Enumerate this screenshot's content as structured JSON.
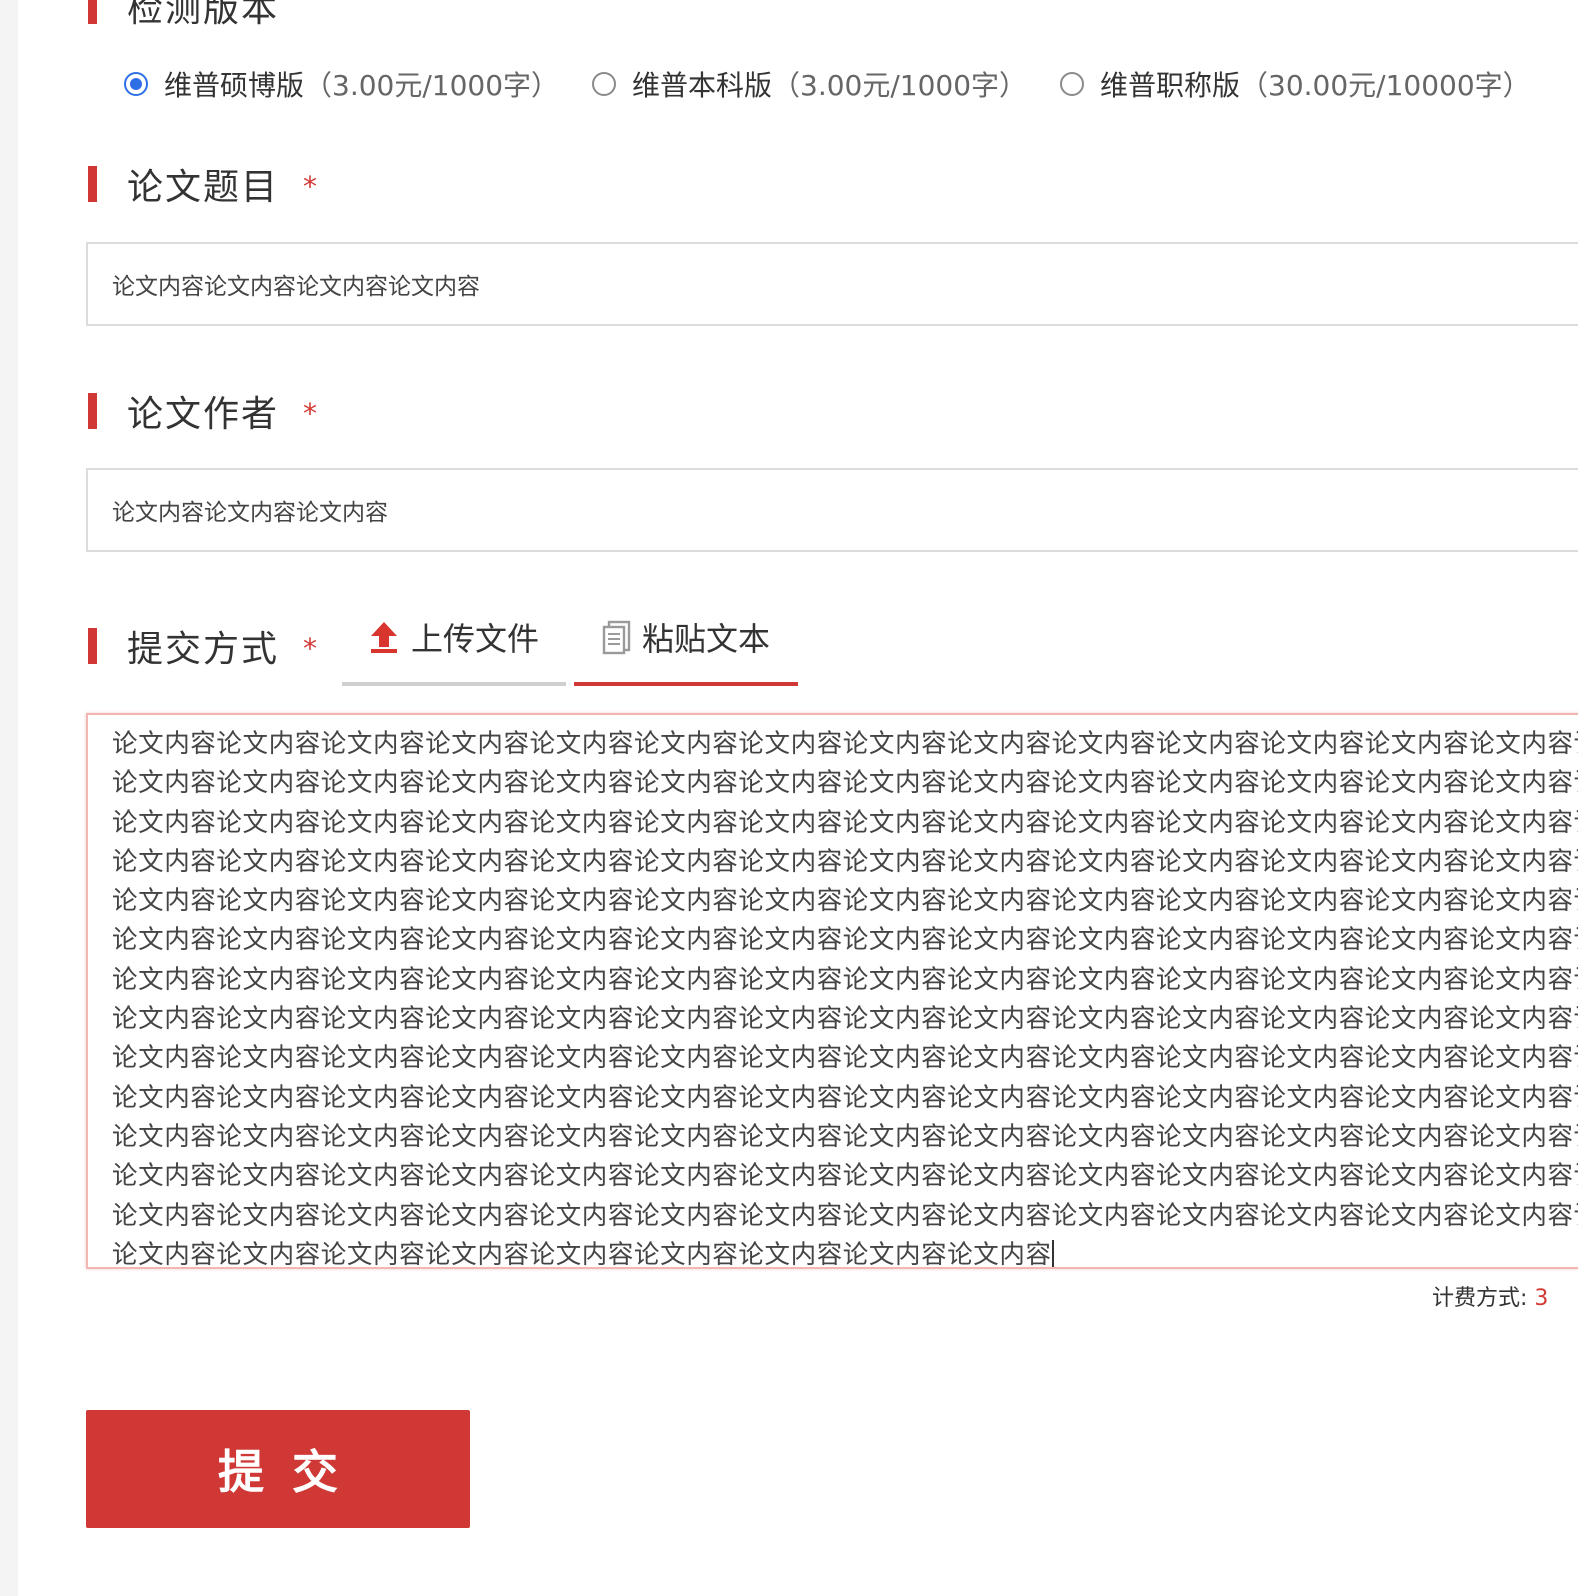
{
  "version_section": {
    "label": "检测版本",
    "options": [
      {
        "label": "维普硕博版",
        "price": "（3.00元/1000字）",
        "selected": true
      },
      {
        "label": "维普本科版",
        "price": "（3.00元/1000字）",
        "selected": false
      },
      {
        "label": "维普职称版",
        "price": "（30.00元/10000字）",
        "selected": false
      }
    ]
  },
  "title_section": {
    "label": "论文题目",
    "required_mark": "*",
    "value": "论文内容论文内容论文内容论文内容"
  },
  "author_section": {
    "label": "论文作者",
    "required_mark": "*",
    "value": "论文内容论文内容论文内容"
  },
  "submit_method": {
    "label": "提交方式",
    "required_mark": "*",
    "tabs": [
      {
        "label": "上传文件",
        "icon": "upload-arrow-icon",
        "active": false
      },
      {
        "label": "粘贴文本",
        "icon": "clipboard-icon",
        "active": true
      }
    ]
  },
  "paste_text": {
    "lines": [
      "论文内容论文内容论文内容论文内容论文内容论文内容论文内容论文内容论文内容论文内容论文内容论文内容论文内容论文内容论",
      "论文内容论文内容论文内容论文内容论文内容论文内容论文内容论文内容论文内容论文内容论文内容论文内容论文内容论文内容论",
      "论文内容论文内容论文内容论文内容论文内容论文内容论文内容论文内容论文内容论文内容论文内容论文内容论文内容论文内容论",
      "论文内容论文内容论文内容论文内容论文内容论文内容论文内容论文内容论文内容论文内容论文内容论文内容论文内容论文内容论",
      "论文内容论文内容论文内容论文内容论文内容论文内容论文内容论文内容论文内容论文内容论文内容论文内容论文内容论文内容论",
      "论文内容论文内容论文内容论文内容论文内容论文内容论文内容论文内容论文内容论文内容论文内容论文内容论文内容论文内容论",
      "论文内容论文内容论文内容论文内容论文内容论文内容论文内容论文内容论文内容论文内容论文内容论文内容论文内容论文内容论",
      "论文内容论文内容论文内容论文内容论文内容论文内容论文内容论文内容论文内容论文内容论文内容论文内容论文内容论文内容论",
      "论文内容论文内容论文内容论文内容论文内容论文内容论文内容论文内容论文内容论文内容论文内容论文内容论文内容论文内容论",
      "论文内容论文内容论文内容论文内容论文内容论文内容论文内容论文内容论文内容论文内容论文内容论文内容论文内容论文内容论",
      "论文内容论文内容论文内容论文内容论文内容论文内容论文内容论文内容论文内容论文内容论文内容论文内容论文内容论文内容论",
      "论文内容论文内容论文内容论文内容论文内容论文内容论文内容论文内容论文内容论文内容论文内容论文内容论文内容论文内容论",
      "论文内容论文内容论文内容论文内容论文内容论文内容论文内容论文内容论文内容论文内容论文内容论文内容论文内容论文内容论",
      "论文内容论文内容论文内容论文内容论文内容论文内容论文内容论文内容论文内容"
    ]
  },
  "billing": {
    "label": "计费方式:",
    "value": "3"
  },
  "submit_button": {
    "label": "提交"
  },
  "colors": {
    "accent": "#cf3834",
    "radio_selected": "#2f6fe6"
  }
}
